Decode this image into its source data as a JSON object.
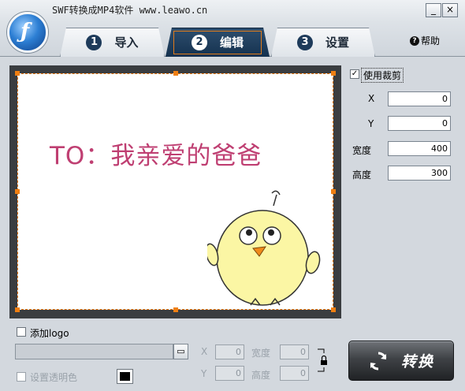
{
  "window": {
    "title": "SWF转换成MP4软件 www.leawo.cn",
    "controls": [
      "_",
      "×"
    ]
  },
  "tabs": [
    {
      "num": "1",
      "label": "导入",
      "active": false
    },
    {
      "num": "2",
      "label": "编辑",
      "active": true
    },
    {
      "num": "3",
      "label": "设置",
      "active": false
    }
  ],
  "help_label": "帮助",
  "preview": {
    "greeting": "TO：我亲爱的爸爸"
  },
  "crop": {
    "checkbox_label": "使用裁剪",
    "checked": true,
    "fields": [
      {
        "label": "X",
        "value": "0"
      },
      {
        "label": "Y",
        "value": "0"
      },
      {
        "label": "宽度",
        "value": "400"
      },
      {
        "label": "高度",
        "value": "300"
      }
    ]
  },
  "logo": {
    "checkbox_label": "添加logo",
    "path_value": "",
    "x_label": "X",
    "x_value": "0",
    "y_label": "Y",
    "y_value": "0",
    "w_label": "宽度",
    "w_value": "0",
    "h_label": "高度",
    "h_value": "0",
    "transparent_label": "设置透明色",
    "transparent_color": "#000000"
  },
  "convert_label": "转换",
  "colors": {
    "accent": "#e9730c",
    "tab_active": "#14314f",
    "greeting": "#bf3f72"
  }
}
